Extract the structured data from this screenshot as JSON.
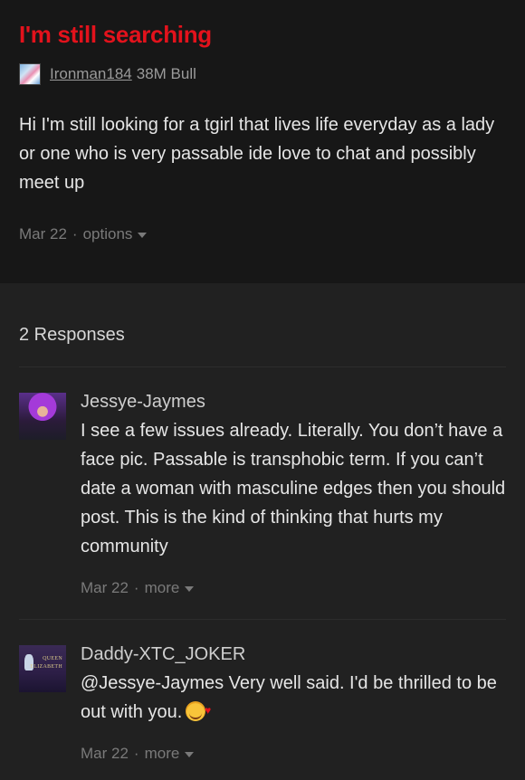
{
  "post": {
    "title": "I'm still searching",
    "author": "Ironman184",
    "author_meta": "38M Bull",
    "body": "Hi I'm still looking for a tgirl that lives life everyday as a lady or one who is very passable ide love to chat and possibly meet up",
    "date": "Mar 22",
    "separator": "·",
    "options_label": "options"
  },
  "responses": {
    "header": "2 Responses",
    "items": [
      {
        "name": "Jessye-Jaymes",
        "text": "I see a few issues already. Literally. You don’t have a face pic. Passable is transphobic term. If you can’t date a woman with masculine edges then you should post. This is the kind of thinking that hurts my community",
        "date": "Mar 22",
        "separator": "·",
        "more_label": "more"
      },
      {
        "name": "Daddy-XTC_JOKER",
        "text": "@Jessye-Jaymes Very well said. I'd be thrilled to be out with you.",
        "emoji": "smiling-face-with-hearts-emoji",
        "avatar_text_1": "QUEEN",
        "avatar_text_2": "ELIZABETH",
        "date": "Mar 22",
        "separator": "·",
        "more_label": "more"
      }
    ]
  },
  "colors": {
    "title": "#e3121c",
    "post_bg": "#171717",
    "page_bg": "#212121",
    "muted": "#7a7a7a"
  }
}
